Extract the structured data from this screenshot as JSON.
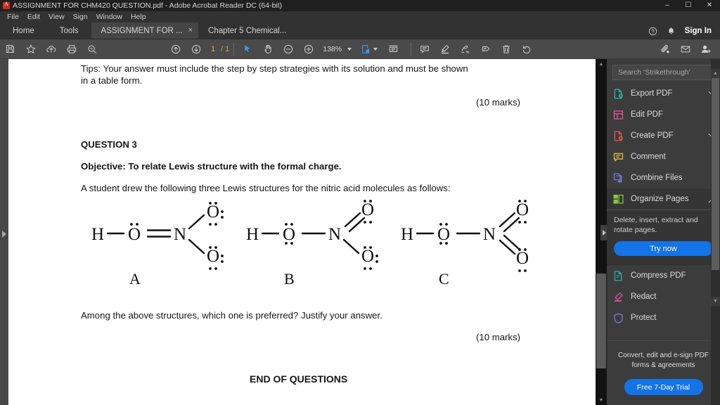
{
  "window": {
    "title": "ASSIGNMENT FOR CHM420 QUESTION.pdf - Adobe Acrobat Reader DC (64-bit)",
    "minimize": "–",
    "maximize": "☐",
    "close": "✕"
  },
  "menubar": {
    "items": [
      "File",
      "Edit",
      "View",
      "Sign",
      "Window",
      "Help"
    ]
  },
  "tabstrip": {
    "home": "Home",
    "tools": "Tools",
    "documents": [
      {
        "label": "ASSIGNMENT FOR ...",
        "close": "×",
        "active": true
      },
      {
        "label": "Chapter 5 Chemical...",
        "close": "",
        "active": false
      }
    ],
    "help_icon": "help-circle-icon",
    "bell_icon": "notification-bell-icon",
    "sign_in": "Sign In"
  },
  "toolbar": {
    "save_icon": "save-icon",
    "star_icon": "add-to-favorites-star-icon",
    "upload_icon": "upload-cloud-icon",
    "print_icon": "print-icon",
    "find_icon": "find-search-icon",
    "prev_page_icon": "previous-page-icon",
    "next_page_icon": "next-page-icon",
    "page_current": "1",
    "page_separator": "/ 1",
    "select_tool_icon": "select-cursor-icon",
    "hand_tool_icon": "hand-pan-icon",
    "zoom_out_icon": "zoom-out-icon",
    "zoom_in_icon": "zoom-in-icon",
    "zoom_level": "138%",
    "fit_page_icon": "fit-page-icon",
    "fullscreen_icon": "read-mode-icon",
    "comment_icon": "add-comment-icon",
    "highlight_icon": "highlight-text-icon",
    "draw_icon": "draw-freehand-icon",
    "stamp_icon": "add-stamp-icon",
    "delete_icon": "delete-icon",
    "undo_icon": "undo-rotate-icon",
    "attach_icon": "attach-file-icon",
    "email_icon": "email-icon",
    "share_icon": "share-add-person-icon"
  },
  "right_panel": {
    "search_placeholder": "Search 'Strikethrough'",
    "tools": [
      {
        "label": "Export PDF",
        "icon": "export-pdf-icon",
        "color": "#2bb3a3",
        "chevron": "down"
      },
      {
        "label": "Edit PDF",
        "icon": "edit-pdf-icon",
        "color": "#e8539e",
        "chevron": ""
      },
      {
        "label": "Create PDF",
        "icon": "create-pdf-icon",
        "color": "#e8574a",
        "chevron": "down"
      },
      {
        "label": "Comment",
        "icon": "comment-icon",
        "color": "#e8c23a",
        "chevron": ""
      },
      {
        "label": "Combine Files",
        "icon": "combine-files-icon",
        "color": "#7b79e0",
        "chevron": ""
      },
      {
        "label": "Organize Pages",
        "icon": "organize-pages-icon",
        "color": "#8cc63f",
        "chevron": "up"
      }
    ],
    "expanded": {
      "description": "Delete, insert, extract and rotate pages.",
      "cta": "Try now"
    },
    "tools_below": [
      {
        "label": "Compress PDF",
        "icon": "compress-pdf-icon",
        "color": "#2bb3a3",
        "chevron": ""
      },
      {
        "label": "Redact",
        "icon": "redact-icon",
        "color": "#e8539e",
        "chevron": ""
      },
      {
        "label": "Protect",
        "icon": "protect-shield-icon",
        "color": "#7b79e0",
        "chevron": ""
      }
    ],
    "promo": {
      "line1": "Convert, edit and e-sign PDF",
      "line2": "forms & agreements",
      "cta": "Free 7-Day Trial"
    },
    "collapse_icon": "collapse-panel-arrow-icon"
  },
  "document": {
    "tips_line1": "Tips: Your answer must include the step by step strategies with its solution and must be shown",
    "tips_line2": "in a table form.",
    "marks_1": "(10 marks)",
    "question_heading": "QUESTION 3",
    "objective": "Objective: To relate Lewis structure with the formal charge.",
    "intro": "A student drew the following three Lewis structures for the nitric acid molecules as follows:",
    "prompt": "Among the above structures, which one is preferred? Justify your answer.",
    "marks_2": "(10 marks)",
    "end": "END OF QUESTIONS",
    "structures": [
      {
        "label": "A",
        "atoms": {
          "h": "H",
          "o_left": "O",
          "n": "N",
          "o_top": "O",
          "o_bottom": "O"
        },
        "bond_h_o": "single",
        "bond_o_n": "double",
        "bond_n_otop": "single",
        "bond_n_obottom": "single"
      },
      {
        "label": "B",
        "atoms": {
          "h": "H",
          "o_left": "O",
          "n": "N",
          "o_top": "O",
          "o_bottom": "O"
        },
        "bond_h_o": "single",
        "bond_o_n": "single",
        "bond_n_otop": "double",
        "bond_n_obottom": "single"
      },
      {
        "label": "C",
        "atoms": {
          "h": "H",
          "o_left": "O",
          "n": "N",
          "o_top": "O",
          "o_bottom": "O"
        },
        "bond_h_o": "single",
        "bond_o_n": "single",
        "bond_n_otop": "double",
        "bond_n_obottom": "double"
      }
    ]
  }
}
